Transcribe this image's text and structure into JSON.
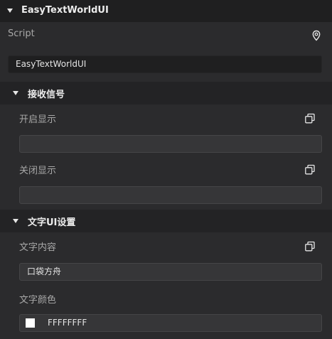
{
  "component": {
    "title": "EasyTextWorldUI",
    "script_label": "Script",
    "script_value": "EasyTextWorldUI"
  },
  "sections": {
    "receive_signal": {
      "title": "接收信号",
      "show_label": "开启显示",
      "show_value": "",
      "hide_label": "关闭显示",
      "hide_value": ""
    },
    "text_ui_settings": {
      "title": "文字UI设置",
      "content_label": "文字内容",
      "content_value": "口袋方舟",
      "color_label": "文字颜色",
      "color_value": "FFFFFFFF",
      "color_swatch": "#ffffff"
    }
  },
  "icons": {
    "collapse": "triangle-down-icon",
    "locate": "location-pin-icon",
    "copy": "copy-icon"
  }
}
